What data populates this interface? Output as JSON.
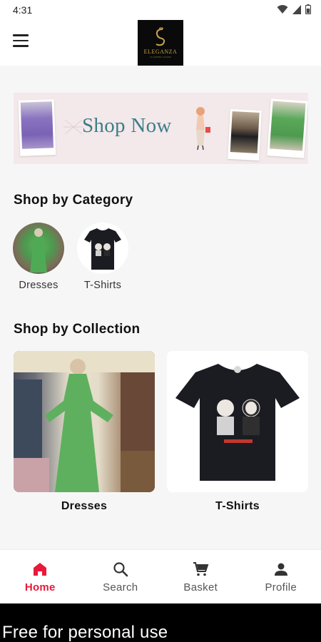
{
  "status_bar": {
    "time": "4:31",
    "icons": [
      "wifi-icon",
      "cellular-signal-icon",
      "battery-icon"
    ]
  },
  "header": {
    "menu_icon": "hamburger-menu-icon",
    "logo_text": "ELEGANZA",
    "logo_subtext": "CLOTHING STORE"
  },
  "banner": {
    "text": "Shop Now"
  },
  "categories": {
    "title": "Shop by Category",
    "items": [
      {
        "label": "Dresses",
        "image": "green-dress-photo"
      },
      {
        "label": "T-Shirts",
        "image": "black-tshirt-photo"
      }
    ]
  },
  "collections": {
    "title": "Shop by Collection",
    "items": [
      {
        "label": "Dresses",
        "image": "green-dress-photo"
      },
      {
        "label": "T-Shirts",
        "image": "black-tshirt-photo"
      }
    ]
  },
  "bottom_nav": {
    "active": "Home",
    "items": [
      {
        "label": "Home",
        "icon": "home-icon"
      },
      {
        "label": "Search",
        "icon": "search-icon"
      },
      {
        "label": "Basket",
        "icon": "cart-icon"
      },
      {
        "label": "Profile",
        "icon": "person-icon"
      }
    ]
  },
  "footer": {
    "text": "Free for personal use"
  },
  "colors": {
    "accent": "#e8193a",
    "banner_bg": "#f3e8ea",
    "banner_text": "#3c7f86",
    "logo_gold": "#c9a54a"
  }
}
